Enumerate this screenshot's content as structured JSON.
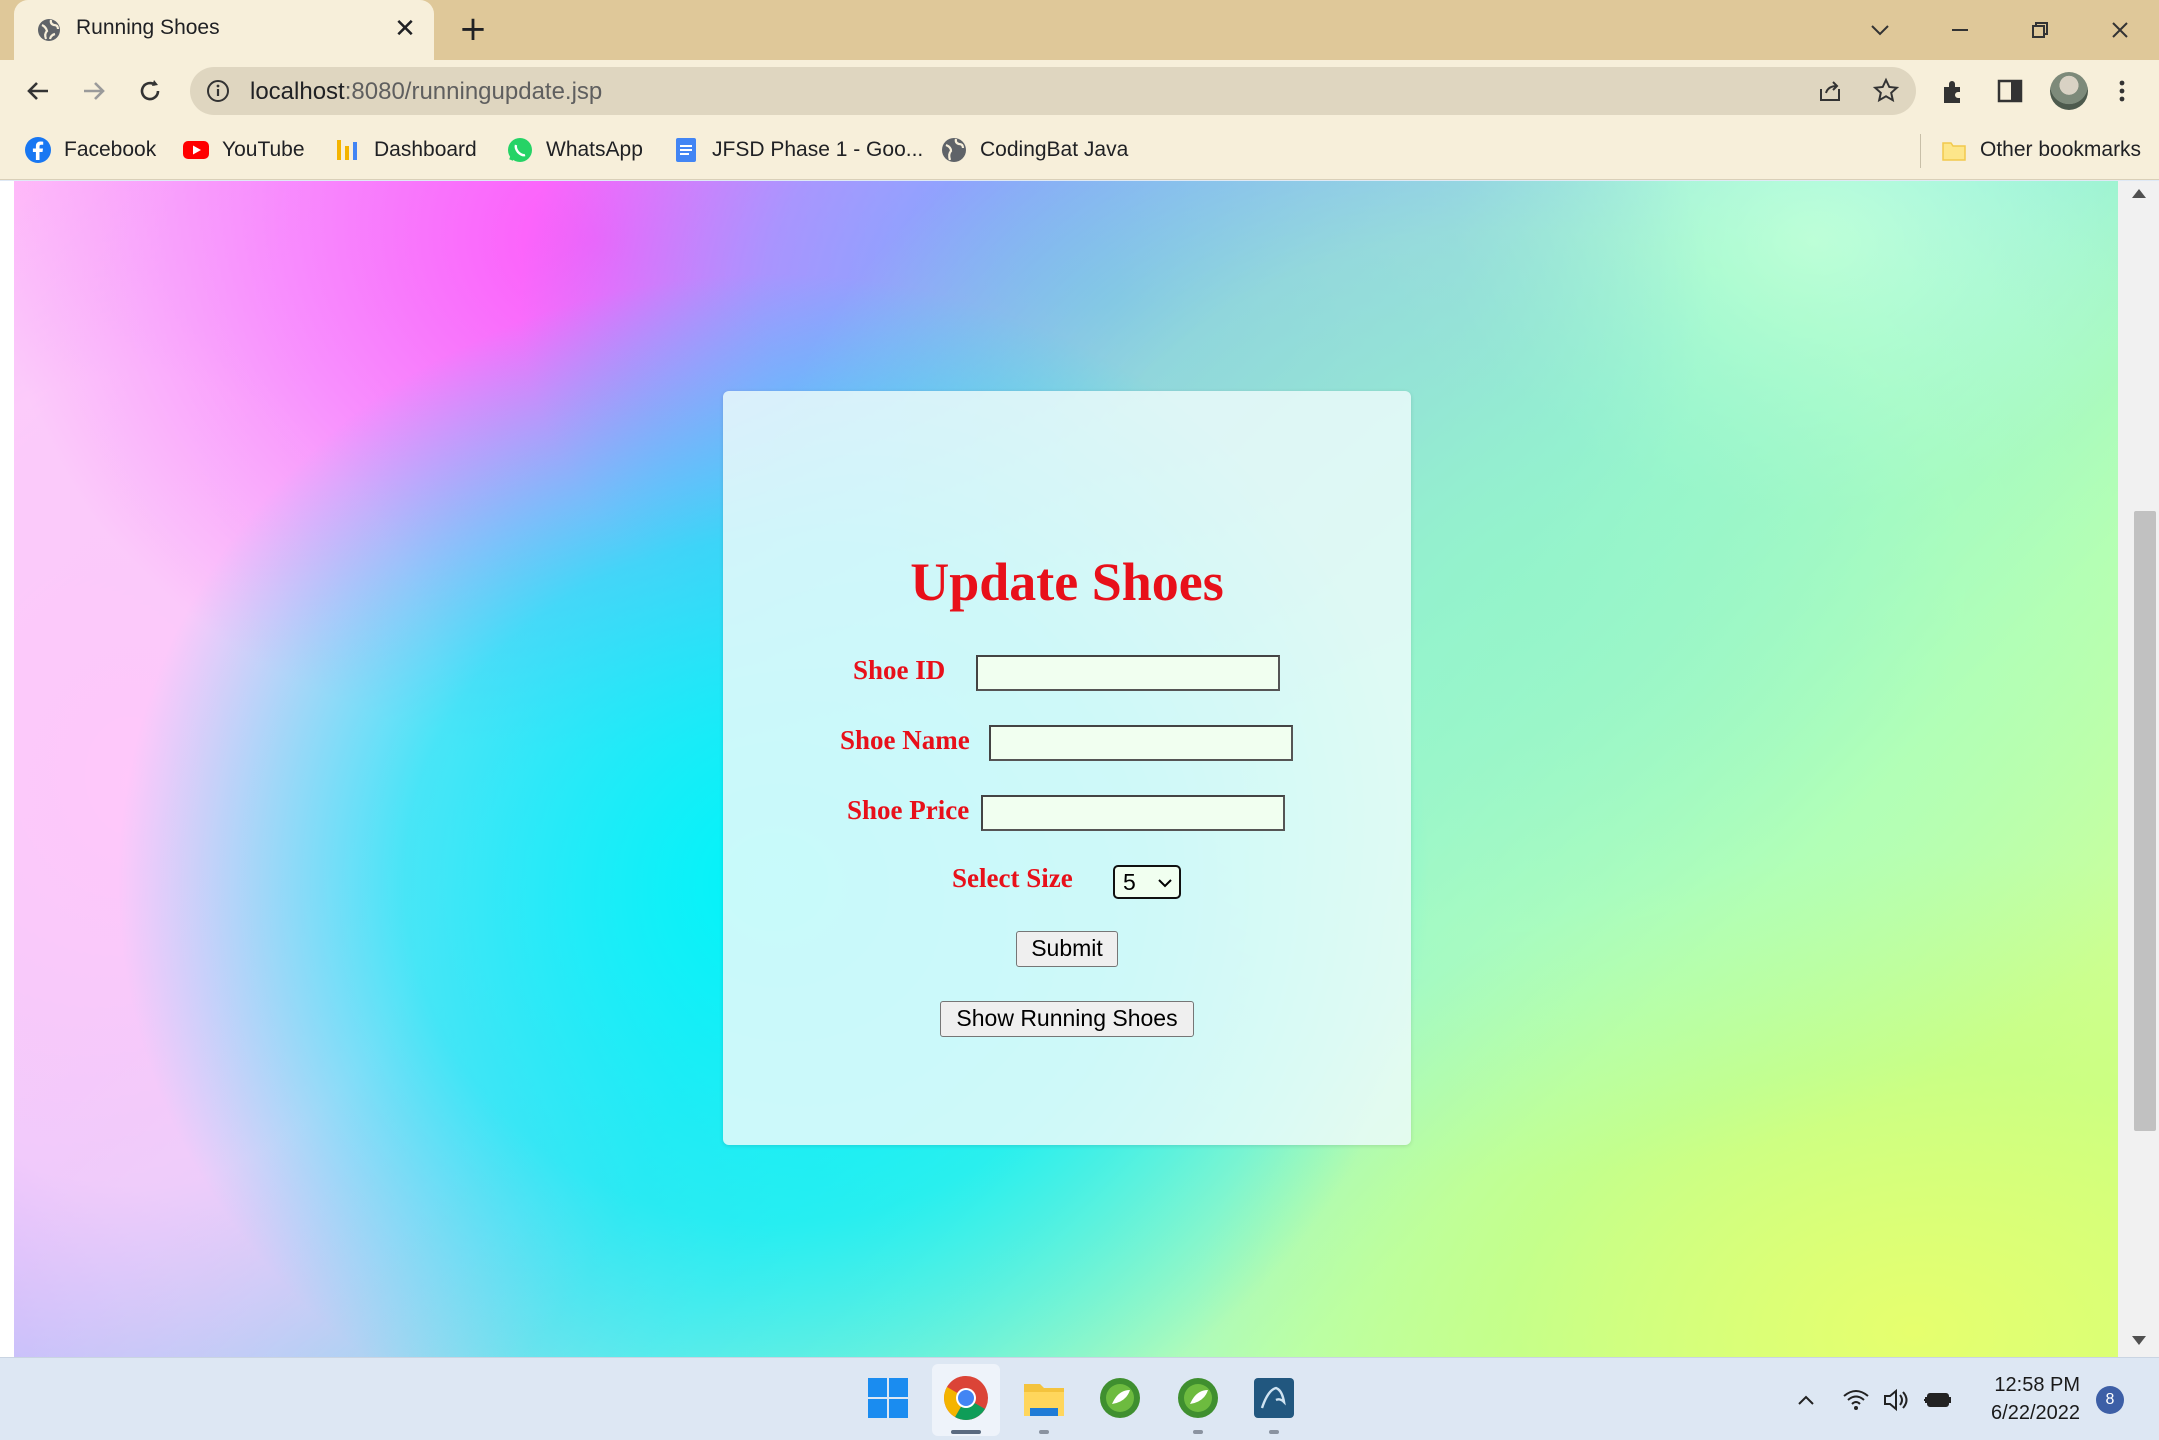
{
  "browser": {
    "tab_title": "Running Shoes",
    "new_tab_symbol": "+",
    "close_symbol": "✕",
    "url_host": "localhost",
    "url_rest": ":8080/runningupdate.jsp"
  },
  "bookmarks": [
    {
      "label": "Facebook",
      "icon": "facebook-icon"
    },
    {
      "label": "YouTube",
      "icon": "youtube-icon"
    },
    {
      "label": "Dashboard",
      "icon": "dashboard-icon"
    },
    {
      "label": "WhatsApp",
      "icon": "whatsapp-icon"
    },
    {
      "label": "JFSD Phase 1 - Goo...",
      "icon": "google-docs-icon"
    },
    {
      "label": "CodingBat Java",
      "icon": "globe-icon"
    }
  ],
  "other_bookmarks": "Other bookmarks",
  "form": {
    "title": "Update Shoes",
    "shoe_id_label": "Shoe ID",
    "shoe_id_value": "",
    "shoe_name_label": "Shoe Name",
    "shoe_name_value": "",
    "shoe_price_label": "Shoe Price",
    "shoe_price_value": "",
    "size_label": "Select Size",
    "size_value": "5",
    "submit_label": "Submit",
    "show_label": "Show Running Shoes"
  },
  "taskbar": {
    "time": "12:58 PM",
    "date": "6/22/2022",
    "notifications": "8"
  },
  "colors": {
    "accent_red": "#e8101a",
    "chrome_frame": "#dfc899",
    "toolbar": "#f7efda"
  }
}
